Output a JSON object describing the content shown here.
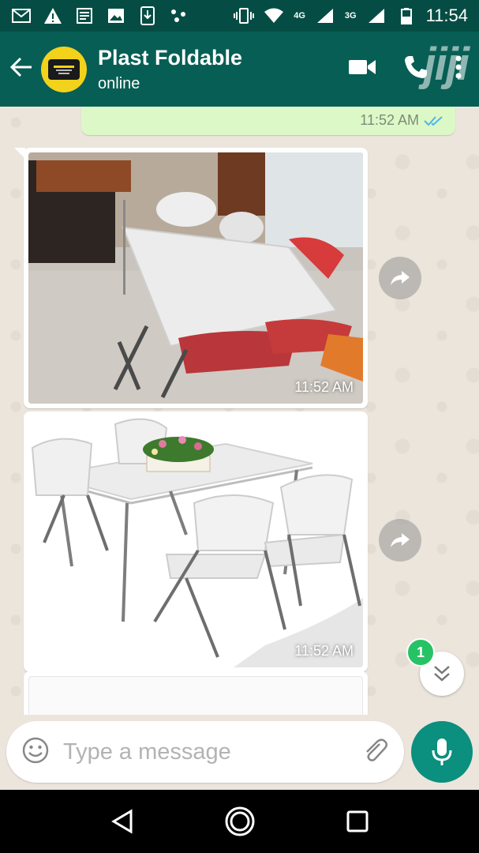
{
  "status_bar": {
    "network_4g": "4G",
    "network_3g": "3G",
    "time": "11:54"
  },
  "header": {
    "contact_name": "Plast Foldable",
    "status": "online",
    "watermark": "jiji"
  },
  "messages": {
    "outgoing_time": "11:52 AM",
    "image1_time": "11:52 AM",
    "image2_time": "11:52 AM"
  },
  "scroll": {
    "unread_count": "1"
  },
  "composer": {
    "placeholder": "Type a message"
  },
  "colors": {
    "header": "#075e54",
    "statusbar": "#054d44",
    "outgoing_bubble": "#dcf8c6",
    "mic_button": "#0b8f7e",
    "unread_badge": "#25c364"
  },
  "icons": {
    "back": "arrow-left-icon",
    "video": "video-camera-icon",
    "call": "phone-icon",
    "menu": "more-vertical-icon",
    "forward": "forward-icon",
    "scroll_down": "chevron-double-down-icon",
    "emoji": "emoji-icon",
    "attach": "paperclip-icon",
    "camera": "camera-icon",
    "mic": "microphone-icon"
  }
}
